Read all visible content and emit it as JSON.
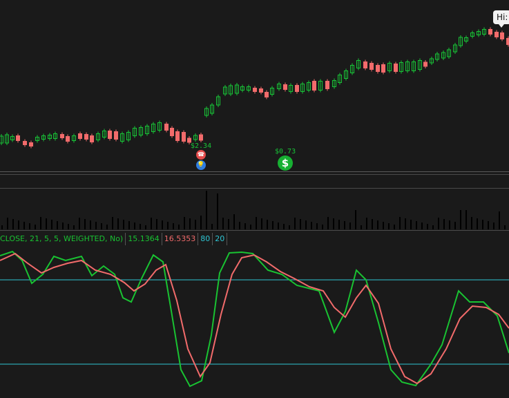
{
  "colors": {
    "background": "#1a1a1a",
    "up": "#18c437",
    "down": "#f26b6b",
    "volume": "#000000",
    "k_line": "#19c332",
    "d_line": "#f26b6b",
    "level_line": "#2ec6d4",
    "separator": "#4a4a4a",
    "info_icon": "#2e7ce0",
    "dividend_icon": "#17b032"
  },
  "price_chart": {
    "tooltip_label": "Hi:",
    "events": [
      {
        "label": "$2.34",
        "icons": [
          "earnings-icon",
          "info-icon"
        ]
      },
      {
        "label": "$0.73",
        "icons": [
          "dividend-icon"
        ]
      }
    ]
  },
  "stochastic": {
    "params_label": "CLOSE, 21, 5, 5, WEIGHTED, No)",
    "k_value": "15.1364",
    "d_value": "16.5353",
    "overbought": "80",
    "oversold": "20"
  }
}
